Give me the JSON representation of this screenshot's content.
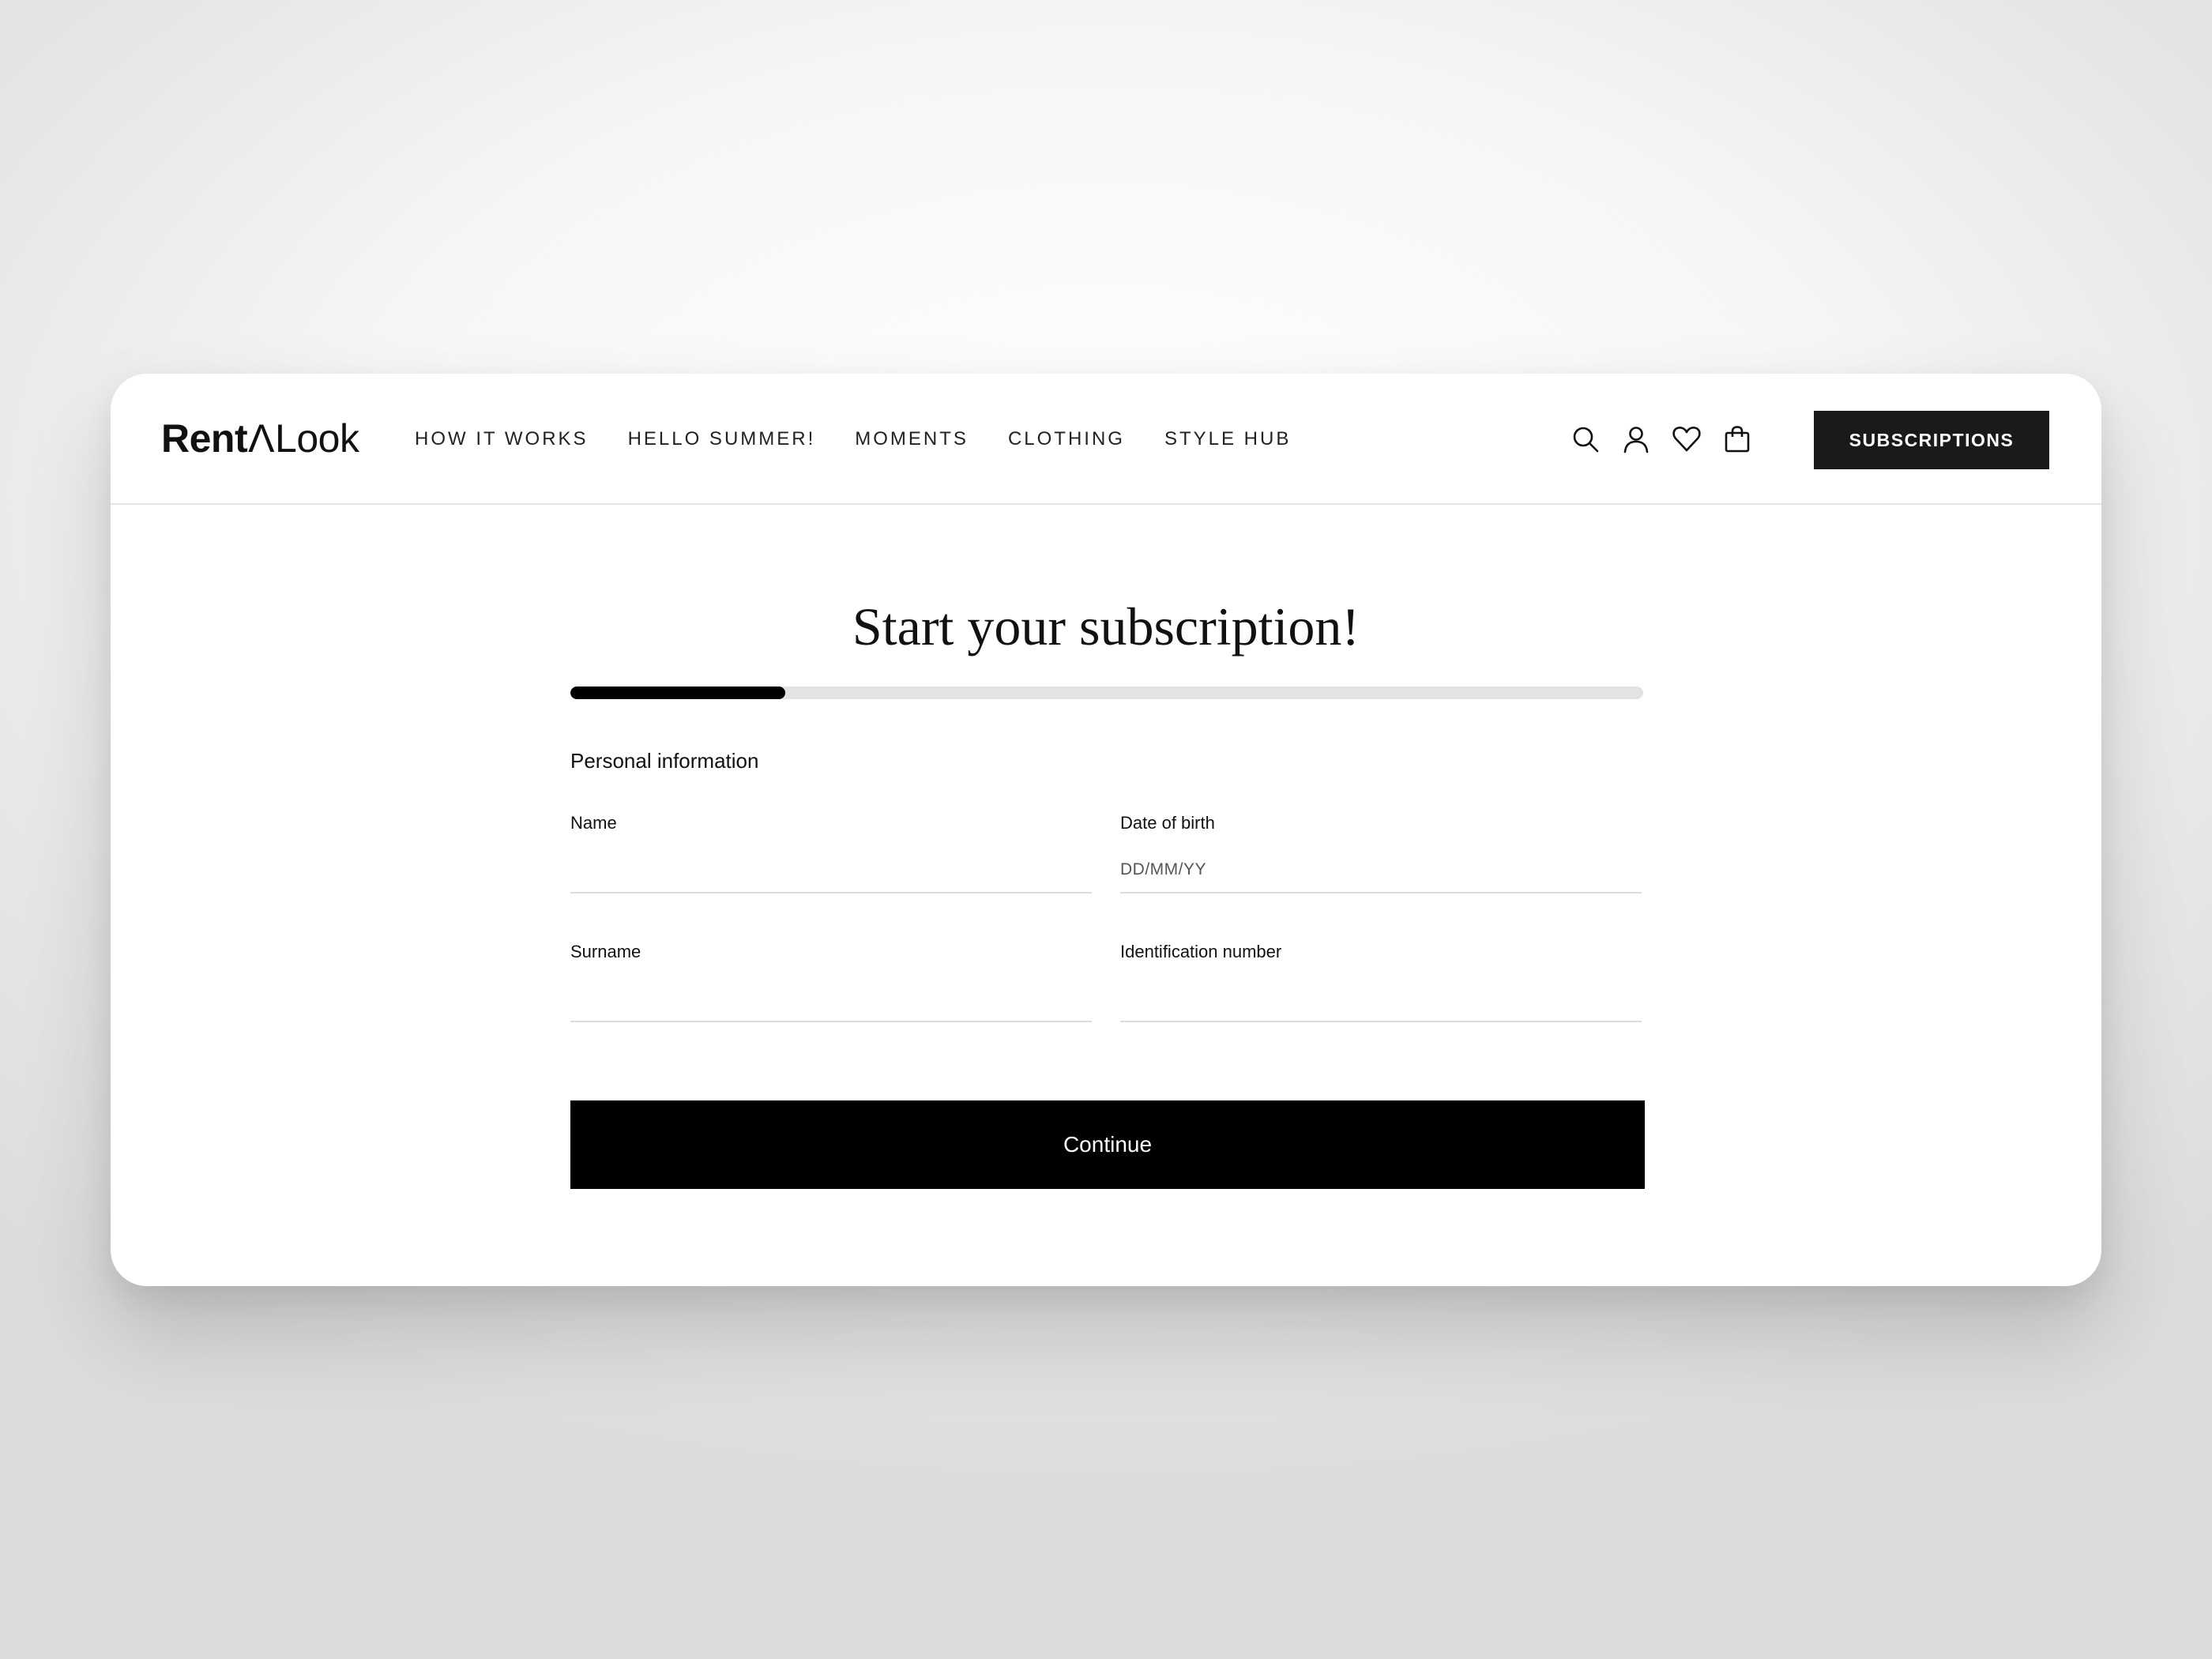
{
  "brand": {
    "part1": "Rent",
    "separator": "Λ",
    "part2": "Look"
  },
  "nav": {
    "items": [
      {
        "label": "HOW IT WORKS"
      },
      {
        "label": "HELLO SUMMER!"
      },
      {
        "label": "MOMENTS"
      },
      {
        "label": "CLOTHING"
      },
      {
        "label": "STYLE HUB"
      }
    ]
  },
  "header_icons": [
    "search-icon",
    "user-icon",
    "heart-icon",
    "shopping-bag-icon"
  ],
  "subscriptions_button": {
    "label": "SUBSCRIPTIONS"
  },
  "page": {
    "title": "Start your subscription!",
    "progress": 0.2,
    "section_title": "Personal information"
  },
  "form": {
    "name": {
      "label": "Name",
      "value": "",
      "placeholder": ""
    },
    "date_of_birth": {
      "label": "Date of birth",
      "value": "",
      "placeholder": "DD/MM/YY"
    },
    "surname": {
      "label": "Surname",
      "value": "",
      "placeholder": ""
    },
    "identification_number": {
      "label": "Identification number",
      "value": "",
      "placeholder": ""
    }
  },
  "continue_button": {
    "label": "Continue"
  },
  "colors": {
    "primary": "#000000",
    "button_dark": "#1a1a1a",
    "track": "#e3e3e3",
    "divider": "#e4e4e4"
  }
}
